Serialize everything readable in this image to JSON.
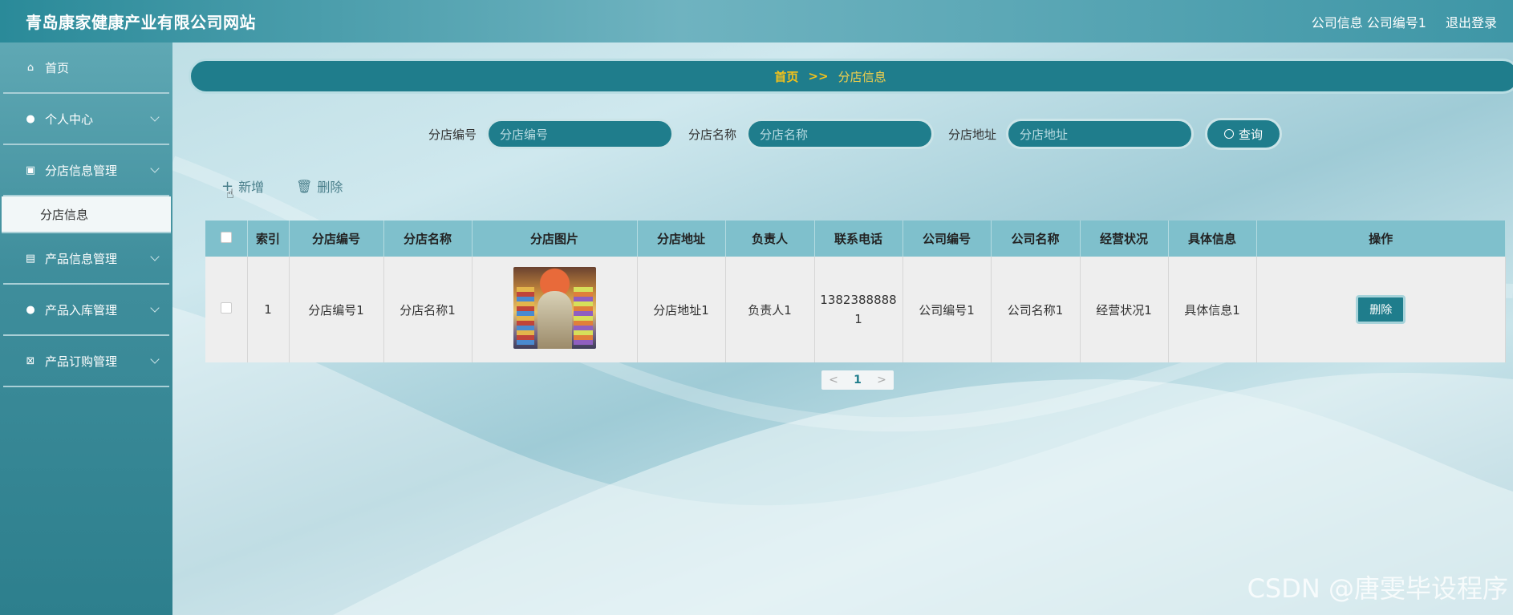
{
  "header": {
    "title": "青岛康家健康产业有限公司网站",
    "company_info": "公司信息 公司编号1",
    "logout": "退出登录"
  },
  "sidebar": {
    "items": [
      {
        "label": "首页",
        "icon": "home-icon"
      },
      {
        "label": "个人中心",
        "icon": "user-icon"
      },
      {
        "label": "分店信息管理",
        "icon": "clipboard-icon"
      },
      {
        "label": "分店信息",
        "icon": ""
      },
      {
        "label": "产品信息管理",
        "icon": "chat-icon"
      },
      {
        "label": "产品入库管理",
        "icon": "user-icon"
      },
      {
        "label": "产品订购管理",
        "icon": "clipboard-x-icon"
      }
    ]
  },
  "breadcrumb": {
    "home": "首页",
    "sep": ">>",
    "current": "分店信息"
  },
  "search": {
    "fields": [
      {
        "label": "分店编号",
        "placeholder": "分店编号"
      },
      {
        "label": "分店名称",
        "placeholder": "分店名称"
      },
      {
        "label": "分店地址",
        "placeholder": "分店地址"
      }
    ],
    "query_label": "查询"
  },
  "actions": {
    "add": "新增",
    "delete": "删除"
  },
  "table": {
    "headers": [
      "",
      "索引",
      "分店编号",
      "分店名称",
      "分店图片",
      "分店地址",
      "负责人",
      "联系电话",
      "公司编号",
      "公司名称",
      "经营状况",
      "具体信息",
      "操作"
    ],
    "rows": [
      {
        "index": "1",
        "code": "分店编号1",
        "name": "分店名称1",
        "address": "分店地址1",
        "manager": "负责人1",
        "phone_line1": "1382388888",
        "phone_line2": "1",
        "company_code": "公司编号1",
        "company_name": "公司名称1",
        "status": "经营状况1",
        "detail": "具体信息1",
        "op": "删除"
      }
    ]
  },
  "pagination": {
    "prev": "<",
    "page": "1",
    "next": ">"
  },
  "watermark": "CSDN @唐雯毕设程序"
}
